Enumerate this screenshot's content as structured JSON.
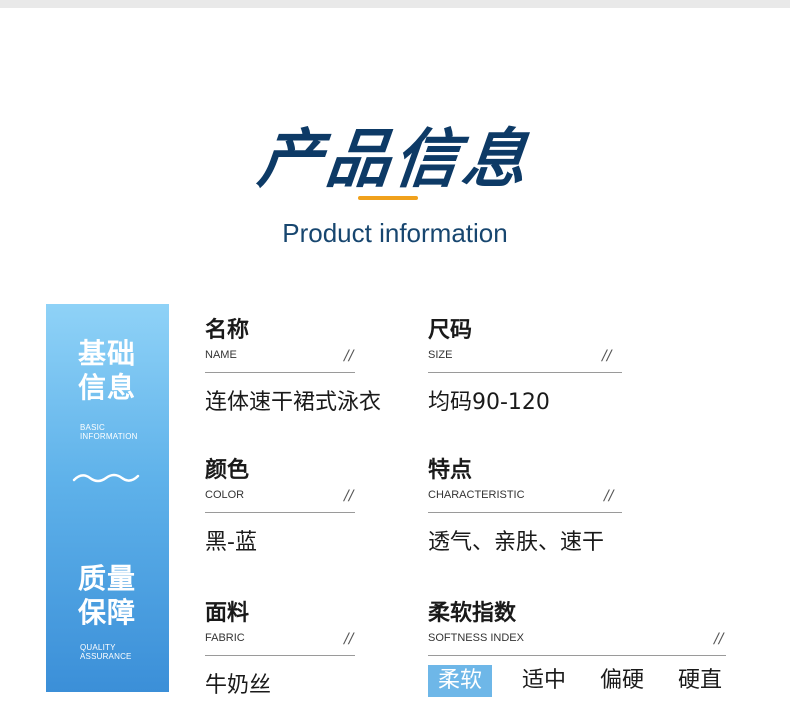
{
  "header": {
    "title": "产品信息",
    "subtitle": "Product information",
    "accent_color": "#f0a11c",
    "title_color": "#0d3a66"
  },
  "sidebar": {
    "section1_cn": [
      "基础",
      "信息"
    ],
    "section1_en": [
      "BASIC",
      "INFORMATION"
    ],
    "divider_icon": "wave-icon",
    "section2_cn": [
      "质量",
      "保障"
    ],
    "section2_en": [
      "QUALITY",
      "ASSURANCE"
    ]
  },
  "fields": {
    "name": {
      "label": "名称",
      "en": "NAME",
      "value": "连体速干裙式泳衣"
    },
    "size": {
      "label": "尺码",
      "en": "SIZE",
      "value": "均码90-120"
    },
    "color": {
      "label": "颜色",
      "en": "COLOR",
      "value": "黑-蓝"
    },
    "feature": {
      "label": "特点",
      "en": "CHARACTERISTIC",
      "value": "透气、亲肤、速干"
    },
    "fabric": {
      "label": "面料",
      "en": "FABRIC",
      "value": "牛奶丝"
    },
    "softness": {
      "label": "柔软指数",
      "en": "SOFTNESS INDEX",
      "options": [
        "柔软",
        "适中",
        "偏硬",
        "硬直"
      ],
      "selected": "柔软",
      "selected_color": "#6eb7e8"
    }
  },
  "slash": "//"
}
